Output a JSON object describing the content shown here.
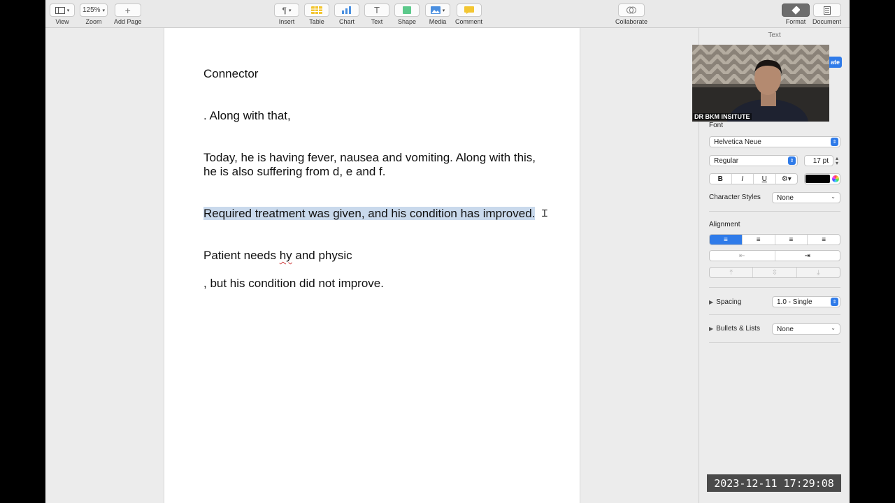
{
  "toolbar": {
    "view": "View",
    "zoom_value": "125%",
    "zoom": "Zoom",
    "add_page": "Add Page",
    "insert": "Insert",
    "table": "Table",
    "chart": "Chart",
    "text": "Text",
    "shape": "Shape",
    "media": "Media",
    "comment": "Comment",
    "collaborate": "Collaborate",
    "format": "Format",
    "document": "Document"
  },
  "document": {
    "p1": "Connector",
    "p2": ". Along with that,",
    "p3": "Today, he is having fever, nausea and vomiting. Along with this, he is also suffering from d, e and f.",
    "p4": "Required treatment was given, and his condition has improved. ",
    "p5_pre": "Patient needs ",
    "p5_mis": "hy",
    "p5_post": " and physic",
    "p6": ", but his condition did not improve."
  },
  "sidebar": {
    "title": "Text",
    "update_btn": "ate",
    "font_label": "Font",
    "font_family": "Helvetica Neue",
    "font_style": "Regular",
    "font_size": "17 pt",
    "bold": "B",
    "italic": "I",
    "underline": "U",
    "char_styles_label": "Character Styles",
    "char_styles_value": "None",
    "alignment_label": "Alignment",
    "spacing_label": "Spacing",
    "spacing_value": "1.0 - Single",
    "bullets_label": "Bullets & Lists",
    "bullets_value": "None",
    "text_color": "#000000",
    "accent": "#2f7be9"
  },
  "overlay": {
    "webcam_caption": "DR BKM INSITUTE",
    "timestamp": "2023-12-11  17:29:08"
  }
}
